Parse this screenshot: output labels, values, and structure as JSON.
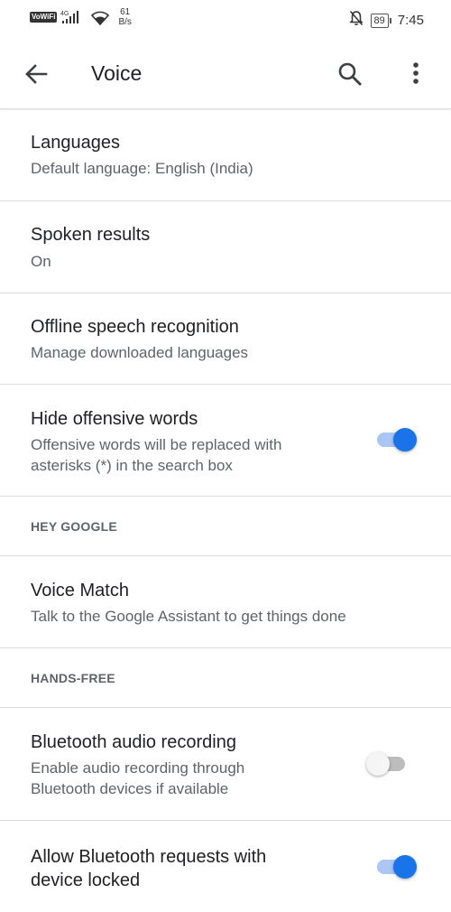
{
  "status_bar": {
    "volte": "VoWiFi",
    "network": "4G",
    "speed_value": "61",
    "speed_unit": "B/s",
    "battery": "89",
    "time": "7:45"
  },
  "app_bar": {
    "title": "Voice",
    "back_icon": "arrow-back-icon",
    "search_icon": "search-icon",
    "more_icon": "more-vert-icon"
  },
  "settings": {
    "languages": {
      "title": "Languages",
      "subtitle": "Default language: English (India)"
    },
    "spoken_results": {
      "title": "Spoken results",
      "subtitle": "On"
    },
    "offline": {
      "title": "Offline speech recognition",
      "subtitle": "Manage downloaded languages"
    },
    "offensive": {
      "title": "Hide offensive words",
      "subtitle_line1": "Offensive words will be replaced with",
      "subtitle_line2": "asterisks (*) in the search box",
      "enabled": true
    },
    "hey_google_header": "HEY GOOGLE",
    "voice_match": {
      "title": "Voice Match",
      "subtitle": "Talk to the Google Assistant to get things done"
    },
    "hands_free_header": "HANDS-FREE",
    "bt_recording": {
      "title": "Bluetooth audio recording",
      "subtitle_line1": "Enable audio recording through",
      "subtitle_line2": "Bluetooth devices if available",
      "enabled": false
    },
    "bt_requests": {
      "title_line1": "Allow Bluetooth requests with",
      "title_line2": "device locked",
      "enabled": true
    }
  },
  "colors": {
    "accent": "#1a73e8",
    "accent_track": "#a9c6f5",
    "divider": "#dadce0"
  }
}
